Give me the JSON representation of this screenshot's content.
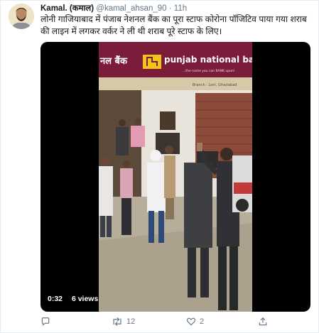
{
  "tweet": {
    "display_name": "Kamal. (कमाल)",
    "handle": "@kamal_ahsan_90",
    "separator": "·",
    "time": "11h",
    "text": "लोनी गाजियाबाद में पंजाब नेशनल बैंक का पूरा स्टाफ कोरोना पॉजिटिव पाया गया शराब की लाइन में लगकर वर्कर ने ली थी शराब पूरे स्टाफ के लिए।"
  },
  "video": {
    "duration": "0:32",
    "views": "6 views",
    "sign_text_left": "नल बैंक",
    "sign_text_brand": "punjab national bank",
    "sign_tagline": "...the name you can BANK upon!",
    "sign_branch": "Branch : Loni, Ghaziabad"
  },
  "actions": {
    "reply_count": "",
    "retweet_count": "12",
    "like_count": "2",
    "share_count": ""
  },
  "colors": {
    "text_primary": "#14171a",
    "text_secondary": "#657786",
    "sign_maroon": "#7b1c3a",
    "sign_yellow": "#f0c419"
  },
  "icons": [
    "reply-icon",
    "retweet-icon",
    "like-icon",
    "share-icon"
  ]
}
